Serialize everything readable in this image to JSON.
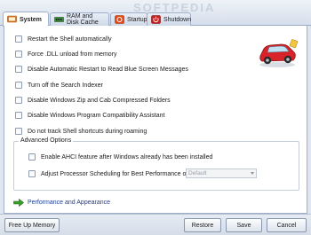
{
  "watermark": "SOFTPEDIA",
  "tabs": [
    {
      "label": "System",
      "icon": "system-icon"
    },
    {
      "label": "RAM and Disk Cache",
      "icon": "ram-icon"
    },
    {
      "label": "Startup",
      "icon": "startup-icon"
    },
    {
      "label": "Shutdown",
      "icon": "shutdown-icon"
    }
  ],
  "options": [
    {
      "label": "Restart the Shell automatically",
      "checked": false
    },
    {
      "label": "Force .DLL unload from memory",
      "checked": false
    },
    {
      "label": "Disable Automatic Restart to Read Blue Screen Messages",
      "checked": false
    },
    {
      "label": "Turn off the Search Indexer",
      "checked": false
    },
    {
      "label": "Disable Windows Zip and Cab Compressed Folders",
      "checked": false
    },
    {
      "label": "Disable Windows Program Compatibility Assistant",
      "checked": false
    },
    {
      "label": "Do not track Shell shortcuts during roaming",
      "checked": false
    }
  ],
  "advanced": {
    "title": "Advanced Options",
    "ahci_label": "Enable AHCI feature after Windows already has been installed",
    "processor_label": "Adjust Processor Scheduling for Best Performance of",
    "processor_value": "Default"
  },
  "perf_link": "Performance and Appearance",
  "buttons": {
    "free_up": "Free Up Memory",
    "restore": "Restore",
    "save": "Save",
    "cancel": "Cancel"
  },
  "colors": {
    "link": "#1f3f95",
    "car_red": "#d8232a",
    "arrow_green": "#3aa02c"
  }
}
